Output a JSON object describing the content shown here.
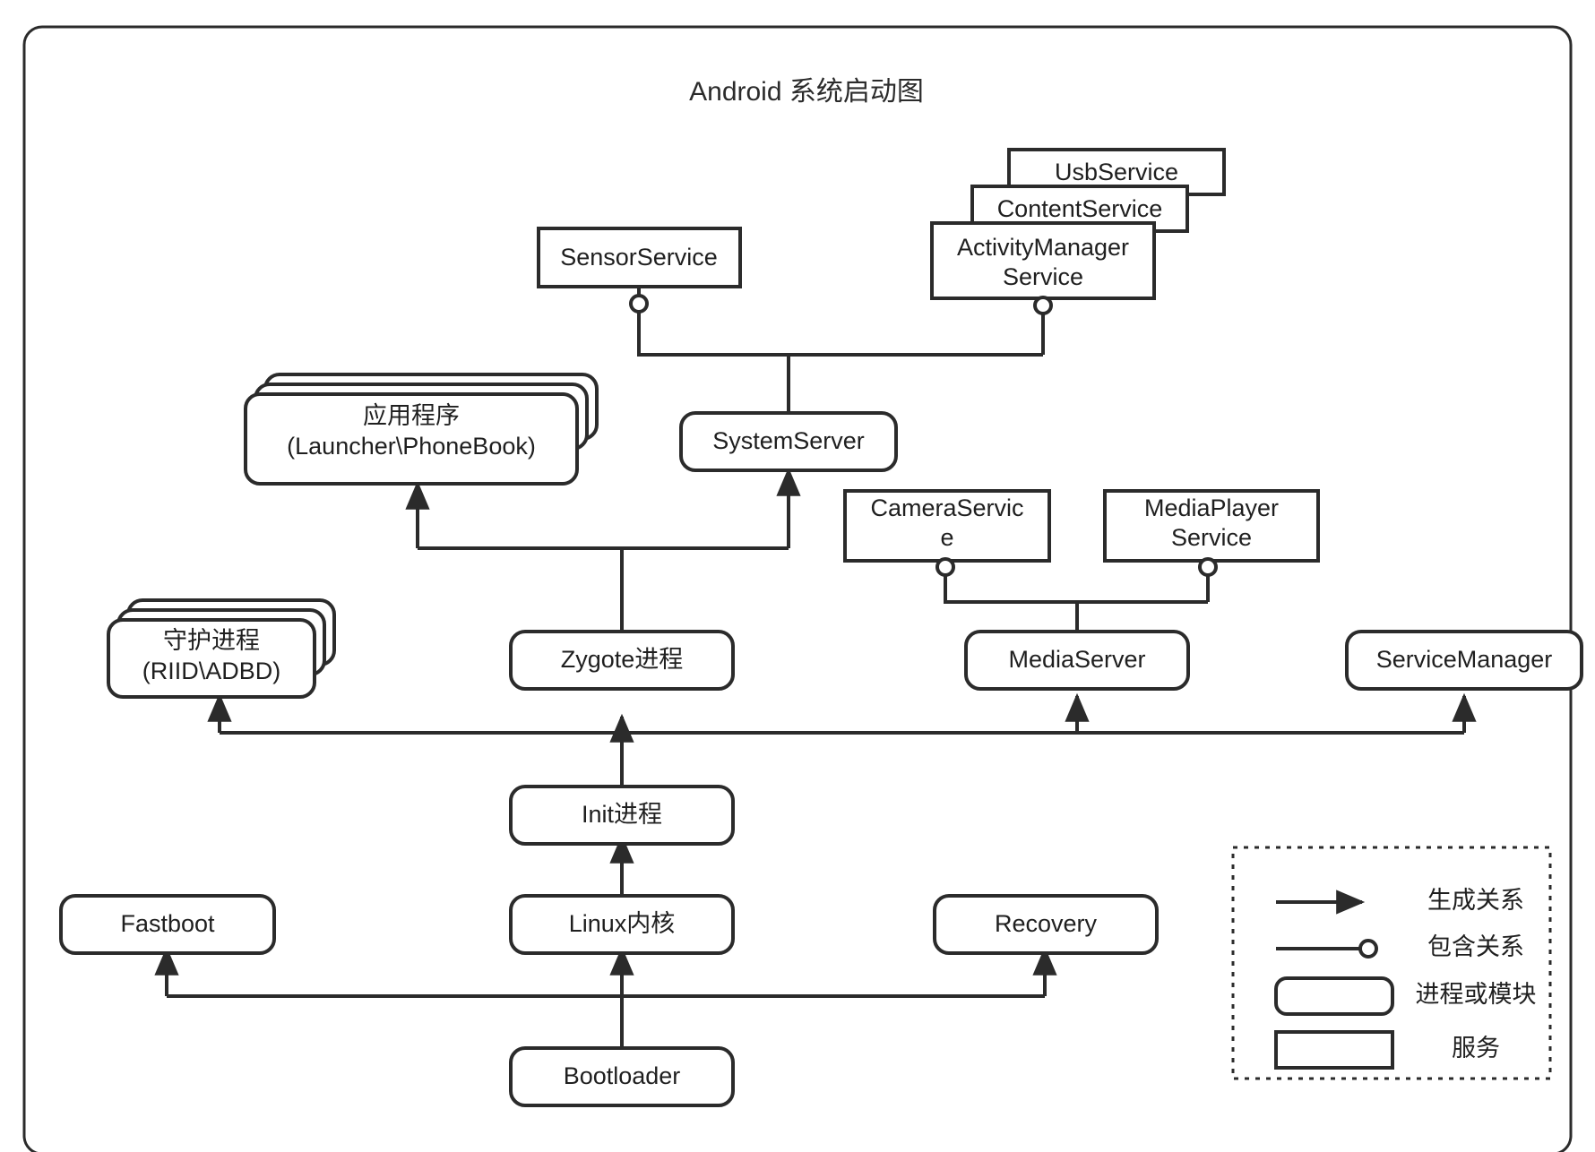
{
  "diagram": {
    "title": "Android 系统启动图",
    "nodes": {
      "usb_service": "UsbService",
      "content_service": "ContentService",
      "activity_manager_service_line1": "ActivityManager",
      "activity_manager_service_line2": "Service",
      "sensor_service": "SensorService",
      "apps_line1": "应用程序",
      "apps_line2": "(Launcher\\PhoneBook)",
      "system_server": "SystemServer",
      "camera_service_line1": "CameraServic",
      "camera_service_line2": "e",
      "media_player_service_line1": "MediaPlayer",
      "media_player_service_line2": "Service",
      "daemon_line1": "守护进程",
      "daemon_line2": "(RIID\\ADBD)",
      "zygote": "Zygote进程",
      "media_server": "MediaServer",
      "service_manager": "ServiceManager",
      "init": "Init进程",
      "fastboot": "Fastboot",
      "linux_kernel": "Linux内核",
      "recovery": "Recovery",
      "bootloader": "Bootloader"
    },
    "legend": {
      "spawn_relation": "生成关系",
      "contains_relation": "包含关系",
      "process_or_module": "进程或模块",
      "service": "服务"
    },
    "colors": {
      "stroke": "#2b2b2b",
      "text": "#1f1f1f",
      "background": "#ffffff"
    }
  }
}
